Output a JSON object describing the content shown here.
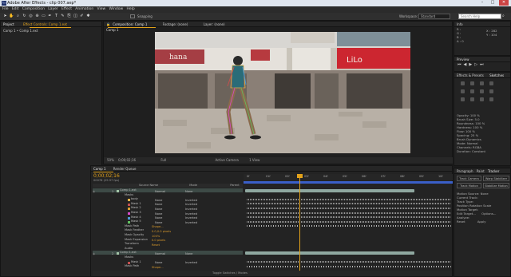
{
  "titlebar": {
    "title": "Adobe After Effects - clip 007.aep*",
    "min": "–",
    "max": "□",
    "close": "✕"
  },
  "menu": [
    "File",
    "Edit",
    "Composition",
    "Layer",
    "Effect",
    "Animation",
    "View",
    "Window",
    "Help"
  ],
  "toolbar": {
    "snapping": "Snapping",
    "workspace_label": "Workspace:",
    "workspace_value": "Standard",
    "search_placeholder": "Search Help"
  },
  "project": {
    "tab": "Project",
    "effect_tab": "Effect Controls: Comp 1.ext",
    "breadcrumb": "Comp 1 • Comp 1.ext"
  },
  "composition": {
    "tab": "Composition: Comp 1",
    "footage_tab": "Footage: (none)",
    "layer_tab": "Layer: (none)",
    "subtab": "Comp 1",
    "shop_signs": [
      "hana",
      "LiLo"
    ]
  },
  "viewer_controls": [
    "50%",
    "0;00;02;16",
    "Full",
    "Active Camera",
    "1 View"
  ],
  "info": {
    "tab": "Info",
    "r": "R :",
    "g": "G :",
    "b": "B :",
    "a": "A : 0",
    "x": "X : 282",
    "y": "Y : 104"
  },
  "preview": {
    "tab": "Preview"
  },
  "effects": {
    "tab": "Effects & Presets",
    "tab2": "Sketches"
  },
  "sketch_rows": [
    "Opacity: 100 %",
    "Brush Size: 5.0",
    "Roundness: 100 %",
    "Hardness: 100 %",
    "Flow: 100 %",
    "Spacing: 25 %",
    "Brush Dynamics",
    "Mode: Normal",
    "Channels: RGBA",
    "Duration: Constant"
  ],
  "tracker": {
    "tab": "Paragraph",
    "tab2": "Paint",
    "tab3": "Tracker",
    "track_camera": "Track Camera",
    "warp_stabilizer": "Warp Stabilizer",
    "track_motion": "Track Motion",
    "stabilize_motion": "Stabilize Motion",
    "motion_source_label": "Motion Source:",
    "motion_source": "None",
    "current_track": "Current Track:",
    "track_type": "Track Type:",
    "position": "Position",
    "rotation": "Rotation",
    "scale": "Scale",
    "motion_target": "Motion Target:",
    "edit_target": "Edit Target...",
    "options": "Options...",
    "analyze": "Analyze:",
    "reset": "Reset",
    "apply": "Apply"
  },
  "timeline": {
    "tab": "Comp 1",
    "tab2": "Render Queue",
    "timecode": "0;00;02;16",
    "fps": "00076 (29.97 fps)",
    "col_source": "Source Name",
    "col_mode": "Mode",
    "col_parent": "Parent",
    "time_labels": [
      "0f",
      "01f",
      "02f",
      "03f",
      "04f",
      "05f",
      "06f",
      "07f",
      "08f",
      "09f",
      "10f"
    ],
    "toggle": "Toggle Switches / Modes",
    "rows": [
      {
        "num": "1",
        "name": "Comp 1.ext",
        "mode": "Normal",
        "parent": "None",
        "color": "#a4c5a8"
      },
      {
        "num": "",
        "name": "Masks",
        "mode": "",
        "parent": "",
        "color": ""
      },
      {
        "num": "",
        "name": "body",
        "mode": "None",
        "parent": "Inverted",
        "color": "#e0b24a"
      },
      {
        "num": "",
        "name": "Mask 1",
        "mode": "None",
        "parent": "Inverted",
        "color": "#c25050"
      },
      {
        "num": "",
        "name": "Mask 2",
        "mode": "None",
        "parent": "Inverted",
        "color": "#d8a030"
      },
      {
        "num": "",
        "name": "Mask 3",
        "mode": "None",
        "parent": "Inverted",
        "color": "#d84ac8"
      },
      {
        "num": "",
        "name": "Mask 4",
        "mode": "None",
        "parent": "Inverted",
        "color": "#4a9ad8"
      },
      {
        "num": "",
        "name": "Mask 5",
        "mode": "None",
        "parent": "Inverted",
        "color": "#60c060"
      },
      {
        "num": "",
        "name": "Mask Path",
        "mode": "Shape...",
        "parent": "",
        "color": ""
      },
      {
        "num": "",
        "name": "Mask Feather",
        "mode": "0.0,0.0 pixels",
        "parent": "",
        "color": ""
      },
      {
        "num": "",
        "name": "Mask Opacity",
        "mode": "100%",
        "parent": "",
        "color": ""
      },
      {
        "num": "",
        "name": "Mask Expansion",
        "mode": "0.0 pixels",
        "parent": "",
        "color": ""
      },
      {
        "num": "",
        "name": "Transform",
        "mode": "Reset",
        "parent": "",
        "color": ""
      },
      {
        "num": "",
        "name": "Audio",
        "mode": "",
        "parent": "",
        "color": ""
      },
      {
        "num": "2",
        "name": "Comp 1.ext",
        "mode": "Normal",
        "parent": "None",
        "color": "#a4c5a8"
      },
      {
        "num": "",
        "name": "Masks",
        "mode": "",
        "parent": "",
        "color": ""
      },
      {
        "num": "",
        "name": "Mask 1",
        "mode": "None",
        "parent": "Inverted",
        "color": "#c25050"
      },
      {
        "num": "",
        "name": "Mask Path",
        "mode": "Shape...",
        "parent": "",
        "color": ""
      }
    ]
  },
  "colors": {
    "accent": "#e3a21a",
    "track": "#8fa8a0",
    "bar_blue": "#3a5fc8"
  }
}
